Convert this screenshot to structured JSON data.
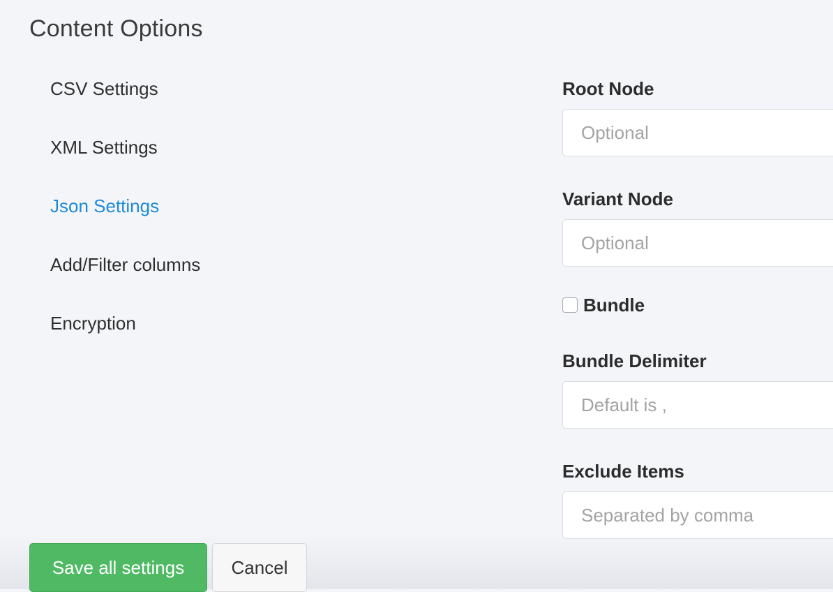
{
  "page": {
    "title": "Content Options"
  },
  "sidebar": {
    "items": [
      {
        "label": "CSV Settings",
        "active": false
      },
      {
        "label": "XML Settings",
        "active": false
      },
      {
        "label": "Json Settings",
        "active": true
      },
      {
        "label": "Add/Filter columns",
        "active": false
      },
      {
        "label": "Encryption",
        "active": false
      }
    ]
  },
  "form": {
    "root_node": {
      "label": "Root Node",
      "value": "",
      "placeholder": "Optional"
    },
    "variant_node": {
      "label": "Variant Node",
      "value": "",
      "placeholder": "Optional"
    },
    "bundle": {
      "label": "Bundle",
      "checked": false
    },
    "bundle_delimiter": {
      "label": "Bundle Delimiter",
      "value": "",
      "placeholder": "Default is ,"
    },
    "exclude_items": {
      "label": "Exclude Items",
      "value": "",
      "placeholder": "Separated by comma"
    }
  },
  "footer": {
    "save_label": "Save all settings",
    "cancel_label": "Cancel"
  },
  "colors": {
    "accent_link": "#1e8bd8",
    "save_button": "#4fb964",
    "background": "#f4f5f9"
  }
}
